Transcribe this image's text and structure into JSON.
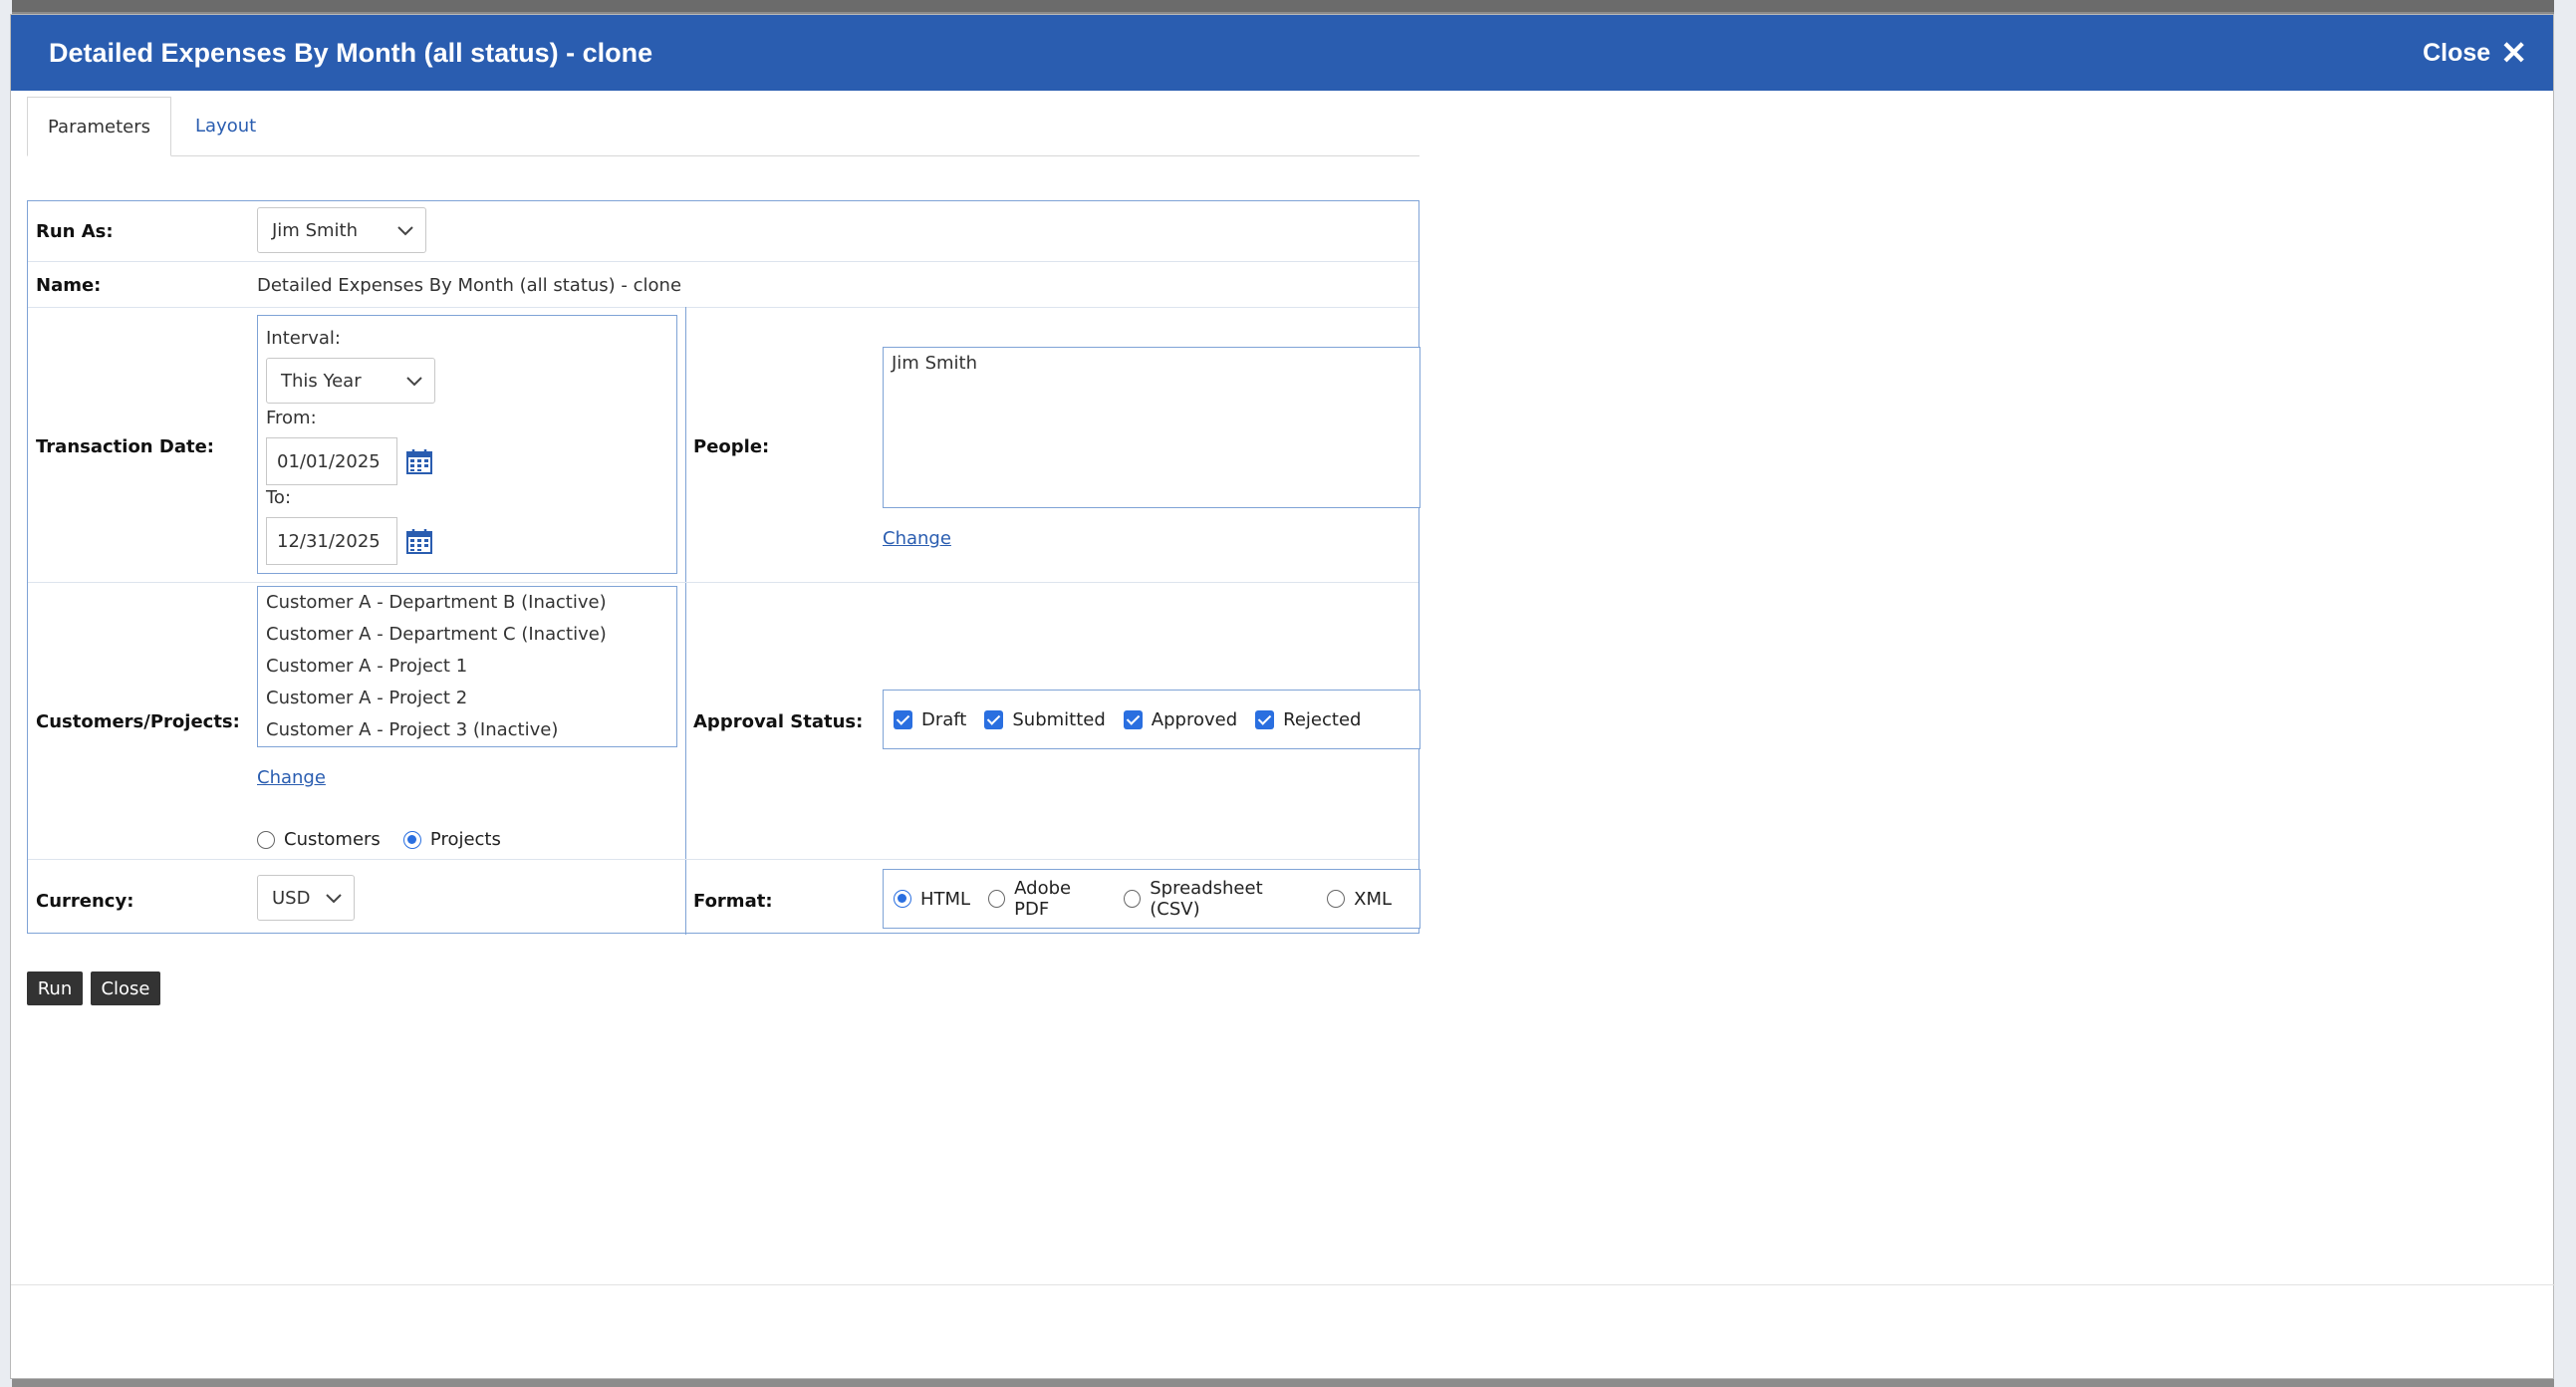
{
  "dialog": {
    "title": "Detailed Expenses By Month (all status) - clone",
    "close_label": "Close"
  },
  "tabs": [
    {
      "label": "Parameters",
      "active": true
    },
    {
      "label": "Layout",
      "active": false
    }
  ],
  "form": {
    "run_as": {
      "label": "Run As:",
      "value": "Jim Smith"
    },
    "name": {
      "label": "Name:",
      "value": "Detailed Expenses By Month (all status) - clone"
    },
    "transaction_date": {
      "label": "Transaction Date:",
      "interval_label": "Interval:",
      "interval_value": "This Year",
      "from_label": "From:",
      "from_value": "01/01/2025",
      "to_label": "To:",
      "to_value": "12/31/2025"
    },
    "people": {
      "label": "People:",
      "items": [
        "Jim Smith"
      ],
      "change_link": "Change"
    },
    "customers_projects": {
      "label": "Customers/Projects:",
      "items": [
        "Customer A - Department B (Inactive)",
        "Customer A - Department C (Inactive)",
        "Customer A - Project 1",
        "Customer A - Project 2",
        "Customer A - Project 3 (Inactive)"
      ],
      "change_link": "Change",
      "mode_options": [
        {
          "label": "Customers",
          "selected": false
        },
        {
          "label": "Projects",
          "selected": true
        }
      ]
    },
    "approval_status": {
      "label": "Approval Status:",
      "options": [
        {
          "label": "Draft",
          "checked": true
        },
        {
          "label": "Submitted",
          "checked": true
        },
        {
          "label": "Approved",
          "checked": true
        },
        {
          "label": "Rejected",
          "checked": true
        }
      ]
    },
    "currency": {
      "label": "Currency:",
      "value": "USD"
    },
    "format": {
      "label": "Format:",
      "options": [
        {
          "label": "HTML",
          "selected": true
        },
        {
          "label": "Adobe PDF",
          "selected": false
        },
        {
          "label": "Spreadsheet (CSV)",
          "selected": false
        },
        {
          "label": "XML",
          "selected": false
        }
      ]
    }
  },
  "buttons": {
    "run": "Run",
    "close": "Close"
  },
  "colors": {
    "header": "#2a5db0",
    "link": "#2a5db0",
    "checkbox": "#2a6fe0",
    "border": "#7fa3d6"
  }
}
